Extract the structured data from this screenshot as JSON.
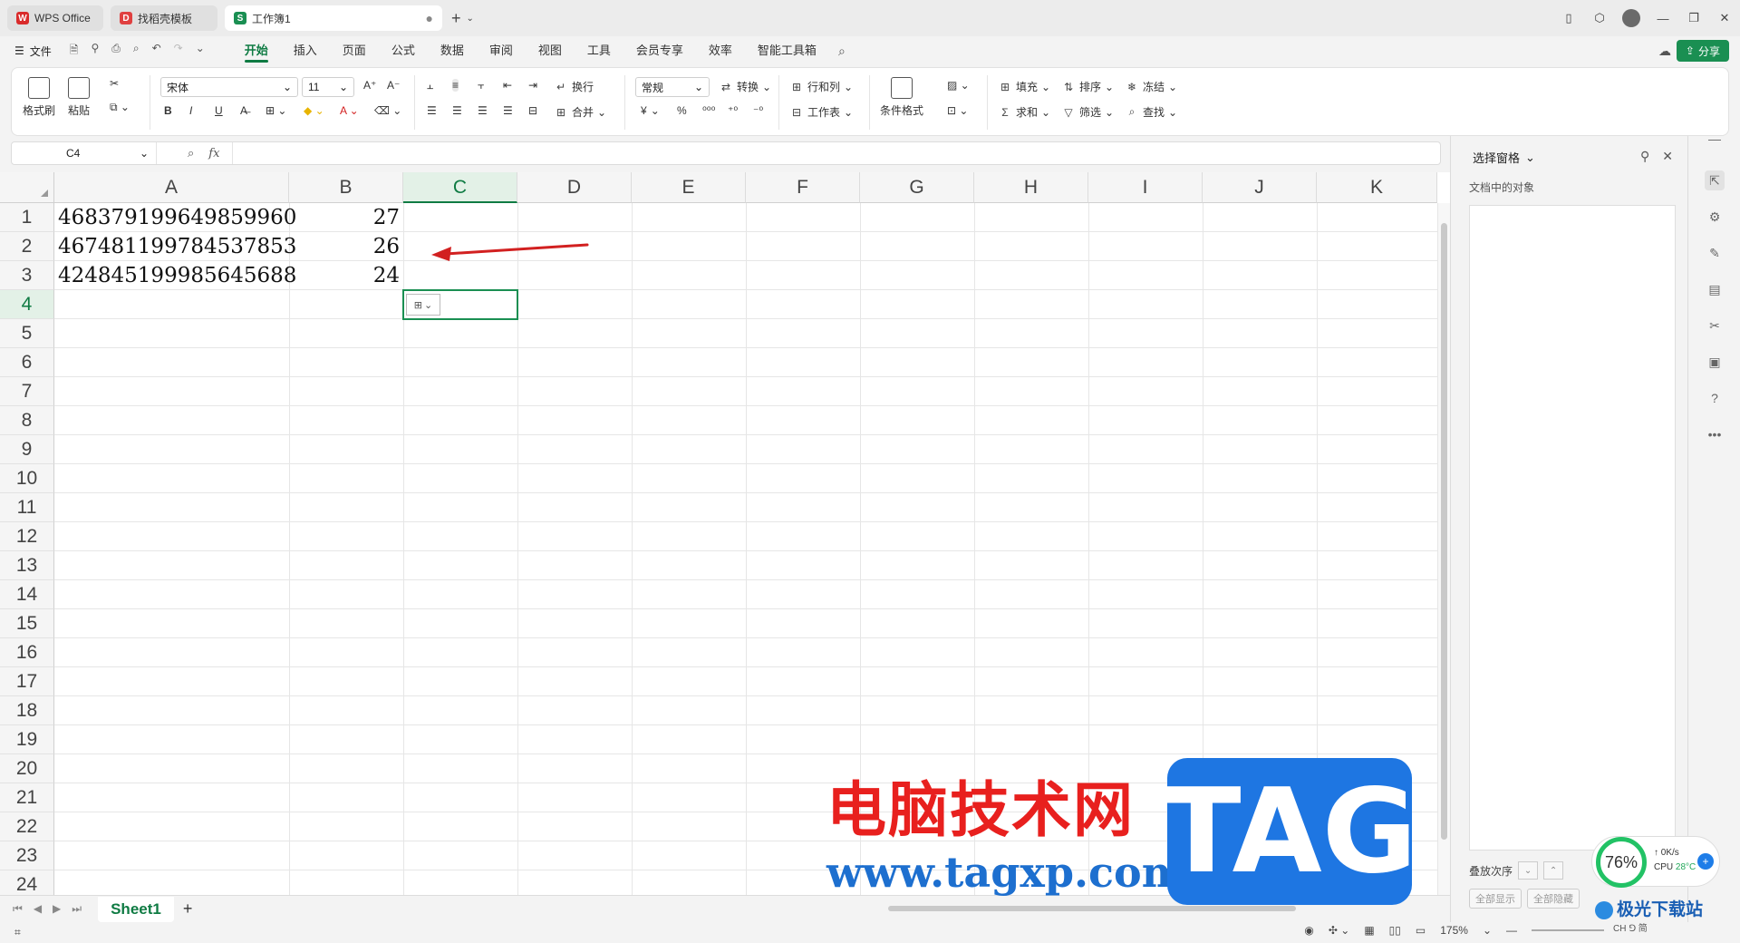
{
  "titlebar": {
    "tabs": [
      {
        "label": "WPS Office",
        "icon": "wps-logo-icon",
        "color": "#d92b2b"
      },
      {
        "label": "找稻壳模板",
        "icon": "docer-icon",
        "color": "#e04040"
      },
      {
        "label": "工作簿1",
        "icon": "spreadsheet-icon",
        "color": "#1a8f52",
        "active": true
      }
    ],
    "new_tab": "+"
  },
  "menubar": {
    "file_label": "文件",
    "items": [
      "开始",
      "插入",
      "页面",
      "公式",
      "数据",
      "审阅",
      "视图",
      "工具",
      "会员专享",
      "效率",
      "智能工具箱"
    ],
    "active": "开始",
    "share_label": "分享"
  },
  "ribbon": {
    "format_painter": "格式刷",
    "paste": "粘贴",
    "font_name": "宋体",
    "font_size": "11",
    "bold": "B",
    "italic": "I",
    "underline": "U",
    "wrap": "换行",
    "merge": "合并",
    "number_format": "常规",
    "convert": "转换",
    "rows_cols": "行和列",
    "worksheet": "工作表",
    "cond_format": "条件格式",
    "fill": "填充",
    "sort": "排序",
    "freeze": "冻结",
    "sum": "求和",
    "filter": "筛选",
    "find": "查找",
    "currency": "¥",
    "percent": "%"
  },
  "formula_bar": {
    "name_box": "C4",
    "fx": "fx",
    "content": ""
  },
  "sheet": {
    "columns": [
      "A",
      "B",
      "C",
      "D",
      "E",
      "F",
      "G",
      "H",
      "I",
      "J",
      "K"
    ],
    "selected_column": "C",
    "rows": [
      "1",
      "2",
      "3",
      "4",
      "5",
      "6",
      "7",
      "8",
      "9",
      "10",
      "11",
      "12",
      "13",
      "14",
      "15",
      "16",
      "17",
      "18",
      "19",
      "20",
      "21",
      "22",
      "23",
      "24"
    ],
    "selected_row": "4",
    "cells": {
      "A1": "468379199649859960",
      "B1": "27",
      "A2": "467481199784537853",
      "B2": "26",
      "A3": "424845199985645688",
      "B3": "24"
    },
    "tab_name": "Sheet1",
    "add_sheet": "+"
  },
  "pane": {
    "title": "选择窗格",
    "subtitle": "文档中的对象",
    "order_label": "叠放次序",
    "show_all": "全部显示",
    "hide_all": "全部隐藏"
  },
  "status": {
    "zoom": "175%"
  },
  "watermark": {
    "cn": "电脑技术网",
    "url": "www.tagxp.com",
    "tag": "TAG",
    "cpu_percent": "76%",
    "net": "0K/s",
    "cpu_label": "CPU",
    "cpu_temp": "28°C",
    "site_logo": "极光下载站",
    "ime": "CH ⅁ 简"
  },
  "colors": {
    "accent": "#0f7b43",
    "arrow": "#d22020"
  }
}
